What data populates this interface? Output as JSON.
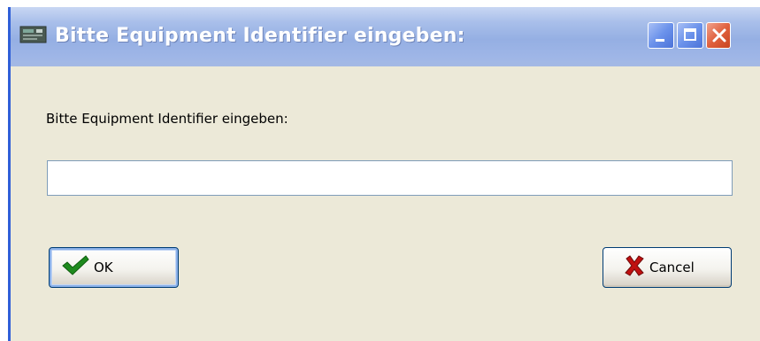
{
  "window": {
    "title": "Bitte Equipment Identifier eingeben:",
    "controls": {
      "minimize_icon": "minimize-icon",
      "maximize_icon": "maximize-icon",
      "close_icon": "close-icon"
    }
  },
  "dialog": {
    "prompt_label": "Bitte Equipment Identifier eingeben:",
    "input": {
      "value": "",
      "placeholder": ""
    },
    "buttons": {
      "ok": {
        "label": "OK",
        "icon": "checkmark-icon"
      },
      "cancel": {
        "label": "Cancel",
        "icon": "cross-icon"
      }
    }
  },
  "colors": {
    "titlebar": "#9FB6E7",
    "window_background": "#ECE9D8",
    "close_button": "#E0613E",
    "ok_icon": "#1E8A1E",
    "cancel_icon": "#C01010"
  }
}
